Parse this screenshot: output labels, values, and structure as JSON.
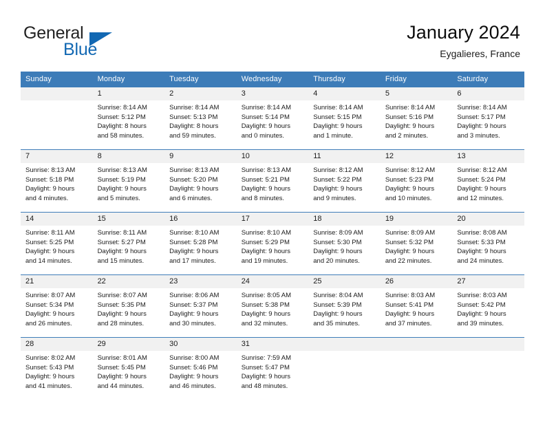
{
  "brand": {
    "name_top": "General",
    "name_bottom": "Blue",
    "accent_color": "#1268b3",
    "logo_icon": "triangle-icon"
  },
  "header": {
    "title": "January 2024",
    "subtitle": "Eygalieres, France"
  },
  "calendar": {
    "header_bg": "#3d7cb8",
    "daynum_bg": "#f1f1f1",
    "weekday_headers": [
      "Sunday",
      "Monday",
      "Tuesday",
      "Wednesday",
      "Thursday",
      "Friday",
      "Saturday"
    ],
    "weeks": [
      [
        {
          "day": "",
          "sunrise": "",
          "sunset": "",
          "daylight1": "",
          "daylight2": ""
        },
        {
          "day": "1",
          "sunrise": "Sunrise: 8:14 AM",
          "sunset": "Sunset: 5:12 PM",
          "daylight1": "Daylight: 8 hours",
          "daylight2": "and 58 minutes."
        },
        {
          "day": "2",
          "sunrise": "Sunrise: 8:14 AM",
          "sunset": "Sunset: 5:13 PM",
          "daylight1": "Daylight: 8 hours",
          "daylight2": "and 59 minutes."
        },
        {
          "day": "3",
          "sunrise": "Sunrise: 8:14 AM",
          "sunset": "Sunset: 5:14 PM",
          "daylight1": "Daylight: 9 hours",
          "daylight2": "and 0 minutes."
        },
        {
          "day": "4",
          "sunrise": "Sunrise: 8:14 AM",
          "sunset": "Sunset: 5:15 PM",
          "daylight1": "Daylight: 9 hours",
          "daylight2": "and 1 minute."
        },
        {
          "day": "5",
          "sunrise": "Sunrise: 8:14 AM",
          "sunset": "Sunset: 5:16 PM",
          "daylight1": "Daylight: 9 hours",
          "daylight2": "and 2 minutes."
        },
        {
          "day": "6",
          "sunrise": "Sunrise: 8:14 AM",
          "sunset": "Sunset: 5:17 PM",
          "daylight1": "Daylight: 9 hours",
          "daylight2": "and 3 minutes."
        }
      ],
      [
        {
          "day": "7",
          "sunrise": "Sunrise: 8:13 AM",
          "sunset": "Sunset: 5:18 PM",
          "daylight1": "Daylight: 9 hours",
          "daylight2": "and 4 minutes."
        },
        {
          "day": "8",
          "sunrise": "Sunrise: 8:13 AM",
          "sunset": "Sunset: 5:19 PM",
          "daylight1": "Daylight: 9 hours",
          "daylight2": "and 5 minutes."
        },
        {
          "day": "9",
          "sunrise": "Sunrise: 8:13 AM",
          "sunset": "Sunset: 5:20 PM",
          "daylight1": "Daylight: 9 hours",
          "daylight2": "and 6 minutes."
        },
        {
          "day": "10",
          "sunrise": "Sunrise: 8:13 AM",
          "sunset": "Sunset: 5:21 PM",
          "daylight1": "Daylight: 9 hours",
          "daylight2": "and 8 minutes."
        },
        {
          "day": "11",
          "sunrise": "Sunrise: 8:12 AM",
          "sunset": "Sunset: 5:22 PM",
          "daylight1": "Daylight: 9 hours",
          "daylight2": "and 9 minutes."
        },
        {
          "day": "12",
          "sunrise": "Sunrise: 8:12 AM",
          "sunset": "Sunset: 5:23 PM",
          "daylight1": "Daylight: 9 hours",
          "daylight2": "and 10 minutes."
        },
        {
          "day": "13",
          "sunrise": "Sunrise: 8:12 AM",
          "sunset": "Sunset: 5:24 PM",
          "daylight1": "Daylight: 9 hours",
          "daylight2": "and 12 minutes."
        }
      ],
      [
        {
          "day": "14",
          "sunrise": "Sunrise: 8:11 AM",
          "sunset": "Sunset: 5:25 PM",
          "daylight1": "Daylight: 9 hours",
          "daylight2": "and 14 minutes."
        },
        {
          "day": "15",
          "sunrise": "Sunrise: 8:11 AM",
          "sunset": "Sunset: 5:27 PM",
          "daylight1": "Daylight: 9 hours",
          "daylight2": "and 15 minutes."
        },
        {
          "day": "16",
          "sunrise": "Sunrise: 8:10 AM",
          "sunset": "Sunset: 5:28 PM",
          "daylight1": "Daylight: 9 hours",
          "daylight2": "and 17 minutes."
        },
        {
          "day": "17",
          "sunrise": "Sunrise: 8:10 AM",
          "sunset": "Sunset: 5:29 PM",
          "daylight1": "Daylight: 9 hours",
          "daylight2": "and 19 minutes."
        },
        {
          "day": "18",
          "sunrise": "Sunrise: 8:09 AM",
          "sunset": "Sunset: 5:30 PM",
          "daylight1": "Daylight: 9 hours",
          "daylight2": "and 20 minutes."
        },
        {
          "day": "19",
          "sunrise": "Sunrise: 8:09 AM",
          "sunset": "Sunset: 5:32 PM",
          "daylight1": "Daylight: 9 hours",
          "daylight2": "and 22 minutes."
        },
        {
          "day": "20",
          "sunrise": "Sunrise: 8:08 AM",
          "sunset": "Sunset: 5:33 PM",
          "daylight1": "Daylight: 9 hours",
          "daylight2": "and 24 minutes."
        }
      ],
      [
        {
          "day": "21",
          "sunrise": "Sunrise: 8:07 AM",
          "sunset": "Sunset: 5:34 PM",
          "daylight1": "Daylight: 9 hours",
          "daylight2": "and 26 minutes."
        },
        {
          "day": "22",
          "sunrise": "Sunrise: 8:07 AM",
          "sunset": "Sunset: 5:35 PM",
          "daylight1": "Daylight: 9 hours",
          "daylight2": "and 28 minutes."
        },
        {
          "day": "23",
          "sunrise": "Sunrise: 8:06 AM",
          "sunset": "Sunset: 5:37 PM",
          "daylight1": "Daylight: 9 hours",
          "daylight2": "and 30 minutes."
        },
        {
          "day": "24",
          "sunrise": "Sunrise: 8:05 AM",
          "sunset": "Sunset: 5:38 PM",
          "daylight1": "Daylight: 9 hours",
          "daylight2": "and 32 minutes."
        },
        {
          "day": "25",
          "sunrise": "Sunrise: 8:04 AM",
          "sunset": "Sunset: 5:39 PM",
          "daylight1": "Daylight: 9 hours",
          "daylight2": "and 35 minutes."
        },
        {
          "day": "26",
          "sunrise": "Sunrise: 8:03 AM",
          "sunset": "Sunset: 5:41 PM",
          "daylight1": "Daylight: 9 hours",
          "daylight2": "and 37 minutes."
        },
        {
          "day": "27",
          "sunrise": "Sunrise: 8:03 AM",
          "sunset": "Sunset: 5:42 PM",
          "daylight1": "Daylight: 9 hours",
          "daylight2": "and 39 minutes."
        }
      ],
      [
        {
          "day": "28",
          "sunrise": "Sunrise: 8:02 AM",
          "sunset": "Sunset: 5:43 PM",
          "daylight1": "Daylight: 9 hours",
          "daylight2": "and 41 minutes."
        },
        {
          "day": "29",
          "sunrise": "Sunrise: 8:01 AM",
          "sunset": "Sunset: 5:45 PM",
          "daylight1": "Daylight: 9 hours",
          "daylight2": "and 44 minutes."
        },
        {
          "day": "30",
          "sunrise": "Sunrise: 8:00 AM",
          "sunset": "Sunset: 5:46 PM",
          "daylight1": "Daylight: 9 hours",
          "daylight2": "and 46 minutes."
        },
        {
          "day": "31",
          "sunrise": "Sunrise: 7:59 AM",
          "sunset": "Sunset: 5:47 PM",
          "daylight1": "Daylight: 9 hours",
          "daylight2": "and 48 minutes."
        },
        {
          "day": "",
          "sunrise": "",
          "sunset": "",
          "daylight1": "",
          "daylight2": ""
        },
        {
          "day": "",
          "sunrise": "",
          "sunset": "",
          "daylight1": "",
          "daylight2": ""
        },
        {
          "day": "",
          "sunrise": "",
          "sunset": "",
          "daylight1": "",
          "daylight2": ""
        }
      ]
    ]
  }
}
